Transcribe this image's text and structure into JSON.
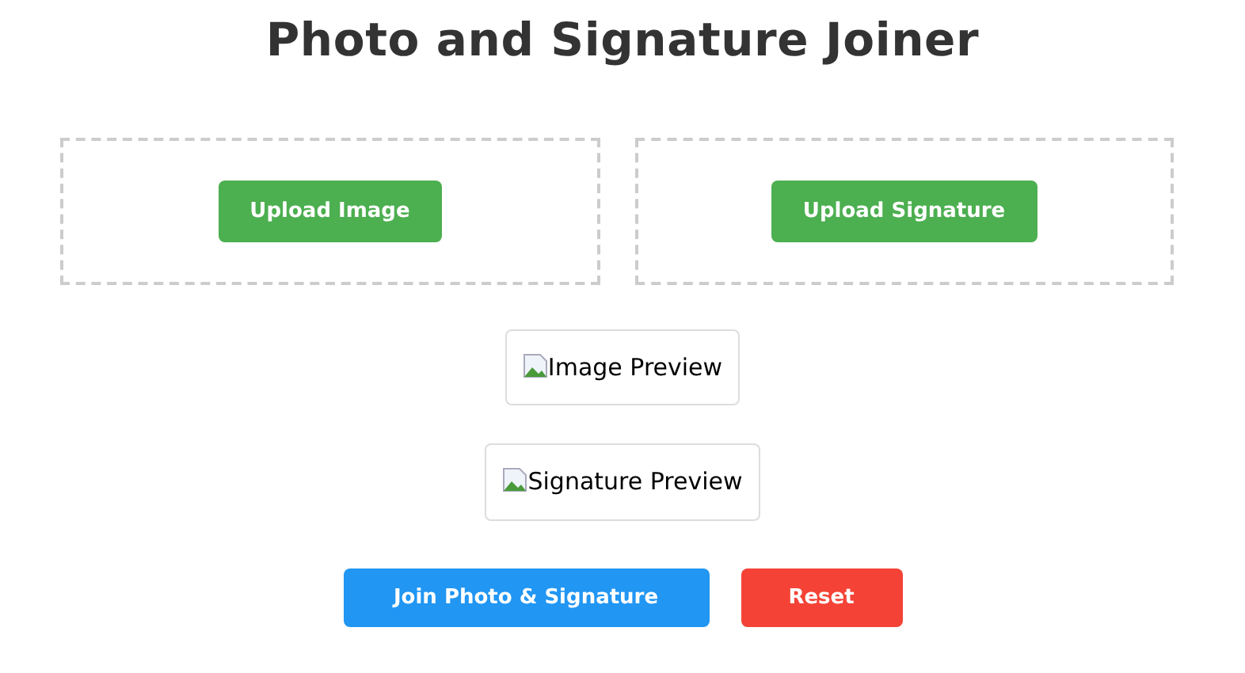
{
  "title": "Photo and Signature Joiner",
  "upload_zones": [
    {
      "button": "Upload Image"
    },
    {
      "button": "Upload Signature"
    }
  ],
  "previews": [
    {
      "alt": "Image Preview"
    },
    {
      "alt": "Signature Preview"
    }
  ],
  "actions": [
    {
      "label": "Join Photo & Signature",
      "kind": "primary"
    },
    {
      "label": "Reset",
      "kind": "danger"
    }
  ]
}
